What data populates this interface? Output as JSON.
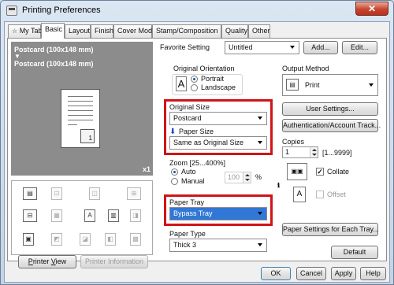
{
  "window": {
    "title": "Printing Preferences",
    "close": "✕"
  },
  "tabs": [
    {
      "label": "My Tab"
    },
    {
      "label": "Basic"
    },
    {
      "label": "Layout"
    },
    {
      "label": "Finish"
    },
    {
      "label": "Cover Mode"
    },
    {
      "label": "Stamp/Composition"
    },
    {
      "label": "Quality"
    },
    {
      "label": "Other"
    }
  ],
  "preview": {
    "paper_line1": "Postcard (100x148 mm)",
    "arrow": "▼",
    "paper_line2": "Postcard (100x148 mm)",
    "page_number": "1",
    "scale": "x1",
    "printer_view_button": "Printer View",
    "printer_info_button": "Printer Information"
  },
  "favorite": {
    "label": "Favorite Setting",
    "value": "Untitled",
    "add_button": "Add...",
    "edit_button": "Edit..."
  },
  "orientation": {
    "label": "Original Orientation",
    "portrait": "Portrait",
    "landscape": "Landscape",
    "icon_letter": "A",
    "selected": "Portrait"
  },
  "original_size": {
    "label": "Original Size",
    "value": "Postcard"
  },
  "paper_size": {
    "label": "Paper Size",
    "value": "Same as Original Size"
  },
  "zoom": {
    "label": "Zoom [25...400%]",
    "auto": "Auto",
    "manual": "Manual",
    "value": "100",
    "unit": "%",
    "selected": "Auto"
  },
  "paper_tray": {
    "label": "Paper Tray",
    "value": "Bypass Tray"
  },
  "paper_type": {
    "label": "Paper Type",
    "value": "Thick 3"
  },
  "output": {
    "label": "Output Method",
    "value": "Print",
    "user_settings_button": "User Settings...",
    "auth_button": "Authentication/Account Track..."
  },
  "copies": {
    "label": "Copies",
    "value": "1",
    "range": "[1...9999]",
    "collate": "Collate",
    "collate_checked": true,
    "offset": "Offset",
    "offset_checked": false
  },
  "paper_settings_button": "Paper Settings for Each Tray...",
  "default_button": "Default",
  "footer": {
    "ok": "OK",
    "cancel": "Cancel",
    "apply": "Apply",
    "help": "Help"
  },
  "colors": {
    "highlight_box": "#d01418",
    "selection": "#3177d6"
  }
}
